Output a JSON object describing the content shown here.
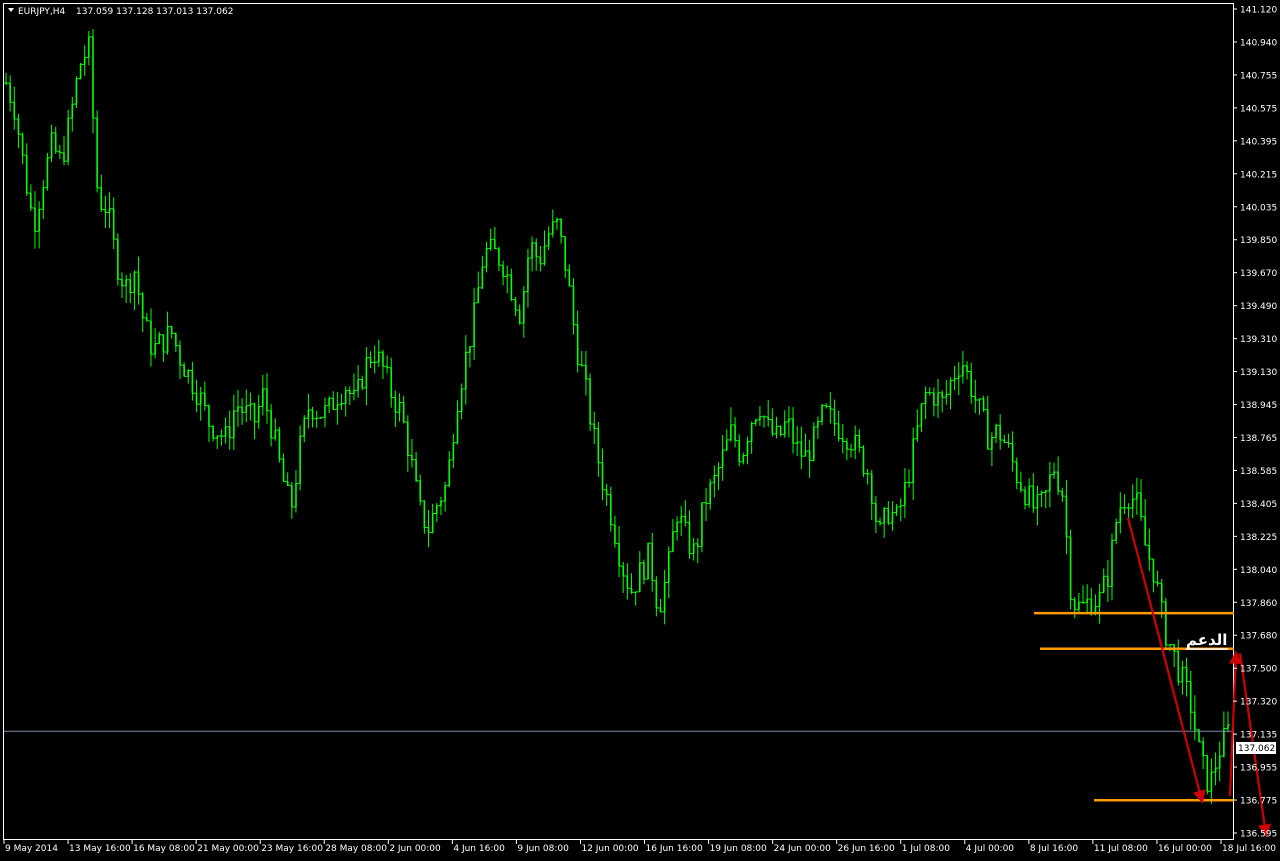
{
  "header": {
    "symbol_tf": "EURJPY,H4",
    "ohlc": "137.059 137.128 137.013 137.062"
  },
  "annotations": {
    "support_label": "الدعم"
  },
  "colors": {
    "background": "#000000",
    "candle": "#00ff00",
    "frame": "#ffffff",
    "level_line": "#ff9900",
    "arrow": "#cc0000",
    "bid_line": "#7a8aa0"
  },
  "chart_data": {
    "type": "line",
    "title": "EURJPY,H4",
    "instrument": "EURJPY",
    "timeframe": "H4",
    "ylim": [
      136.48,
      141.12
    ],
    "y_ticks": [
      "141.120",
      "140.940",
      "140.755",
      "140.575",
      "140.395",
      "140.215",
      "140.035",
      "139.850",
      "139.670",
      "139.490",
      "139.310",
      "139.130",
      "138.945",
      "138.765",
      "138.585",
      "138.405",
      "138.225",
      "138.040",
      "137.860",
      "137.680",
      "137.500",
      "137.320",
      "137.135",
      "136.955",
      "136.775",
      "136.595"
    ],
    "x_ticks": [
      "9 May 2014",
      "13 May 16:00",
      "16 May 08:00",
      "21 May 00:00",
      "23 May 16:00",
      "28 May 08:00",
      "2 Jun 00:00",
      "4 Jun 16:00",
      "9 Jun 08:00",
      "12 Jun 00:00",
      "16 Jun 16:00",
      "19 Jun 08:00",
      "24 Jun 00:00",
      "26 Jun 16:00",
      "1 Jul 08:00",
      "4 Jul 00:00",
      "8 Jul 16:00",
      "11 Jul 08:00",
      "16 Jul 00:00",
      "18 Jul 16:00"
    ],
    "current_price": "137.062",
    "series": [
      {
        "close": [
          140.7,
          140.55,
          140.2,
          139.9,
          140.15,
          140.35,
          140.25,
          140.5,
          140.8,
          140.9,
          140.05,
          140.0,
          139.7,
          139.55,
          139.65,
          139.35,
          139.2,
          139.25,
          139.3,
          139.15,
          139.05,
          138.95,
          138.8,
          138.75,
          138.7,
          138.9,
          138.85,
          138.8,
          138.95,
          138.75,
          138.5,
          138.3,
          138.65,
          138.9,
          138.85,
          138.85,
          138.95,
          139.0,
          138.9,
          139.1,
          139.2,
          139.1,
          138.95,
          138.85,
          138.6,
          138.3,
          138.2,
          138.35,
          138.45,
          138.9,
          139.15,
          139.4,
          139.75,
          139.75,
          139.7,
          139.55,
          139.4,
          139.8,
          139.7,
          139.85,
          139.9,
          139.65,
          139.25,
          139.0,
          138.7,
          138.45,
          138.25,
          138.0,
          137.85,
          137.95,
          138.05,
          137.75,
          137.95,
          138.3,
          138.15,
          138.05,
          138.35,
          138.45,
          138.6,
          138.75,
          138.6,
          138.8,
          138.9,
          138.75,
          138.7,
          138.8,
          138.65,
          138.6,
          138.7,
          138.85,
          138.8,
          138.75,
          138.7,
          138.6,
          138.5,
          138.15,
          138.3,
          138.25,
          138.45,
          138.7,
          138.95,
          138.95,
          138.9,
          139.05,
          139.15,
          139.0,
          138.85,
          138.7,
          138.75,
          138.65,
          138.5,
          138.4,
          138.3,
          138.35,
          138.55,
          138.4,
          137.8,
          137.75,
          137.8,
          137.8,
          137.95,
          138.3,
          138.4,
          138.35,
          138.1,
          137.95,
          137.65,
          137.5,
          137.35,
          137.2,
          136.9,
          136.75,
          136.95,
          137.06
        ]
      }
    ],
    "levels": [
      137.725,
      137.525,
      136.675
    ]
  }
}
